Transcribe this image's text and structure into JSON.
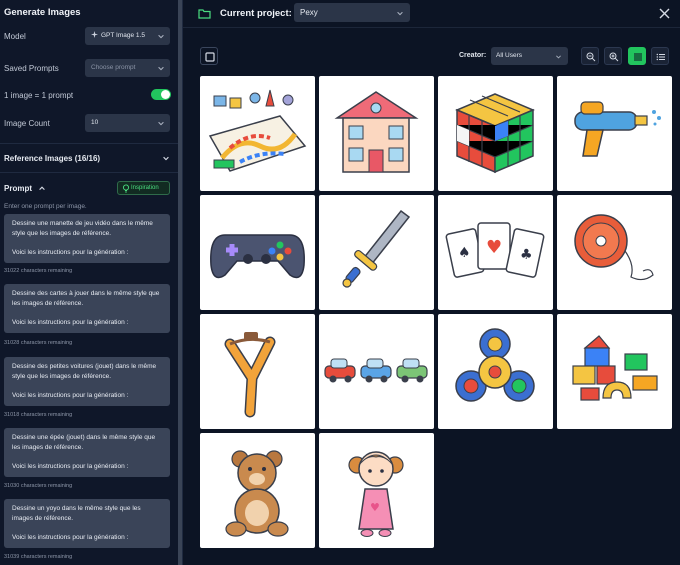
{
  "sidebar": {
    "title": "Generate Images",
    "model": {
      "label": "Model",
      "value": "GPT Image 1.5"
    },
    "saved_prompts": {
      "label": "Saved Prompts",
      "placeholder": "Choose prompt"
    },
    "one_image": {
      "label": "1 image = 1 prompt",
      "enabled": true
    },
    "image_count": {
      "label": "Image Count",
      "value": "10"
    },
    "reference_images": {
      "label": "Reference Images (16/16)"
    },
    "prompt_section": {
      "label": "Prompt",
      "inspiration_label": "Inspiration",
      "hint": "Enter one prompt per image.",
      "prompts": [
        {
          "line1": "Dessine une manette de jeu vidéo dans le même style que les images de référence.",
          "line2": "Voici les instructions pour la génération :",
          "remaining": "31022 characters remaining"
        },
        {
          "line1": "Dessine des cartes à jouer dans le même style que les images de référence.",
          "line2": "Voici les instructions pour la génération :",
          "remaining": "31028 characters remaining"
        },
        {
          "line1": "Dessine des petites voitures (jouet) dans le même style que les images de référence.",
          "line2": "Voici les instructions pour la génération :",
          "remaining": "31018 characters remaining"
        },
        {
          "line1": "Dessine une épée (jouet) dans le même style que les images de référence.",
          "line2": "Voici les instructions pour la génération :",
          "remaining": "31030 characters remaining"
        },
        {
          "line1": "Dessine un yoyo dans le même style que les images de référence.",
          "line2": "Voici les instructions pour la génération :",
          "remaining": "31039 characters remaining"
        }
      ]
    }
  },
  "header": {
    "project_label": "Current project:",
    "project_value": "Pexy"
  },
  "toolbar": {
    "creator_label": "Creator:",
    "creator_value": "All Users"
  },
  "images": [
    "board-game",
    "dollhouse",
    "rubiks-cube",
    "water-gun",
    "game-controller",
    "toy-sword",
    "playing-cards",
    "yoyo",
    "slingshot",
    "toy-cars",
    "fidget-spinner",
    "building-blocks",
    "teddy-bear",
    "doll"
  ],
  "colors": {
    "accent": "#22c55e",
    "bg": "#0e1629",
    "panel": "#2b3548"
  }
}
